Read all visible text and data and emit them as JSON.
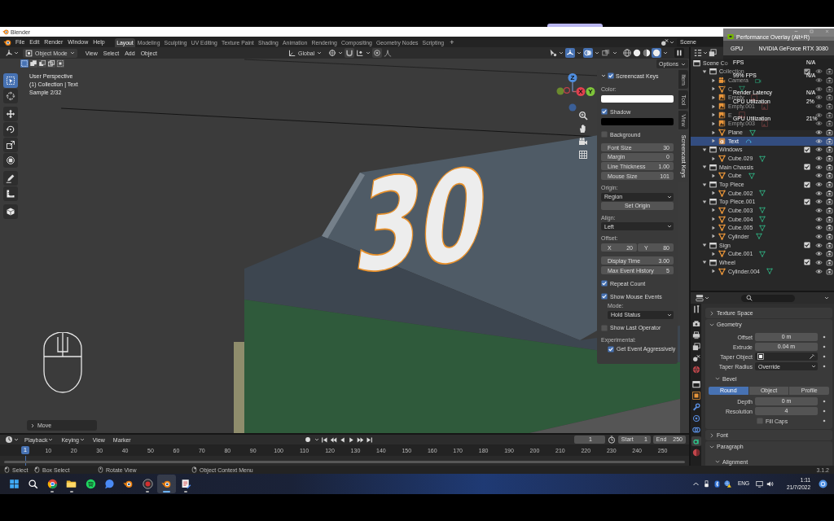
{
  "window": {
    "title": "Blender"
  },
  "topbar": {
    "menus": [
      "File",
      "Edit",
      "Render",
      "Window",
      "Help"
    ],
    "workspaces": [
      {
        "label": "Layout",
        "selected": true
      },
      {
        "label": "Modeling",
        "selected": false
      },
      {
        "label": "Sculpting",
        "selected": false
      },
      {
        "label": "UV Editing",
        "selected": false
      },
      {
        "label": "Texture Paint",
        "selected": false
      },
      {
        "label": "Shading",
        "selected": false
      },
      {
        "label": "Animation",
        "selected": false
      },
      {
        "label": "Rendering",
        "selected": false
      },
      {
        "label": "Compositing",
        "selected": false
      },
      {
        "label": "Geometry Nodes",
        "selected": false
      },
      {
        "label": "Scripting",
        "selected": false
      }
    ],
    "add_tab": "+",
    "scene": "Scene"
  },
  "performance_overlay": {
    "title": "Performance Overlay (Alt+R)",
    "gpu": {
      "label": "GPU",
      "value": "NVIDIA GeForce RTX 3080"
    },
    "stats": [
      {
        "label": "FPS",
        "value": "N/A"
      },
      {
        "label": "99% FPS",
        "value": "N/A"
      },
      {
        "label": "Render Latency",
        "value": "N/A"
      },
      {
        "label": "CPU Utilization",
        "value": "2%"
      },
      {
        "label": "GPU Utilization",
        "value": "21%"
      }
    ]
  },
  "viewport_header": {
    "mode": "Object Mode",
    "menus": [
      "View",
      "Select",
      "Add",
      "Object"
    ],
    "orientation": "Global",
    "toggles": [
      {
        "kind": "gizmos",
        "on": true
      },
      {
        "kind": "overlays",
        "on": true
      },
      {
        "kind": "xray",
        "on": false
      }
    ],
    "shading": [
      {
        "kind": "wireframe",
        "selected": false
      },
      {
        "kind": "solid",
        "selected": false
      },
      {
        "kind": "material",
        "selected": false
      },
      {
        "kind": "rendered",
        "selected": true
      }
    ],
    "options": "Options"
  },
  "select_modes": [
    {
      "kind": "set",
      "selected": true
    },
    {
      "kind": "extend",
      "selected": false
    },
    {
      "kind": "subtract",
      "selected": false
    },
    {
      "kind": "difference",
      "selected": false
    },
    {
      "kind": "intersect",
      "selected": false
    }
  ],
  "tools": [
    {
      "kind": "select",
      "selected": true
    },
    {
      "kind": "cursor",
      "selected": false
    },
    {
      "kind": "move",
      "selected": false
    },
    {
      "kind": "rotate",
      "selected": false
    },
    {
      "kind": "scale",
      "selected": false
    },
    {
      "kind": "transform",
      "selected": false
    },
    {
      "kind": "annotate",
      "selected": false
    },
    {
      "kind": "measure",
      "selected": false
    },
    {
      "kind": "add_cube",
      "selected": false
    }
  ],
  "viewport": {
    "info": [
      "User Perspective",
      "(1) Collection | Text",
      "Sample 2/32"
    ],
    "axes": [
      "Z",
      "X",
      "Y"
    ],
    "scene_text": "30",
    "last_operator": {
      "label": "Move",
      "expanded": false
    }
  },
  "sidebar": {
    "tabs": [
      {
        "label": "Item",
        "selected": false
      },
      {
        "label": "Tool",
        "selected": false
      },
      {
        "label": "View",
        "selected": false
      },
      {
        "label": "Screencast Keys",
        "selected": true
      }
    ],
    "panel": {
      "title": "Screencast Keys",
      "enabled": true,
      "expanded": true,
      "items": [
        {
          "kind": "label",
          "text": "Color:"
        },
        {
          "kind": "color",
          "color": "#ffffff"
        },
        {
          "kind": "checkbox",
          "label": "Shadow",
          "checked": true
        },
        {
          "kind": "color",
          "color": "#000000"
        },
        {
          "kind": "checkbox",
          "label": "Background",
          "checked": false
        },
        {
          "kind": "number",
          "label": "Font Size",
          "value": "30"
        },
        {
          "kind": "number",
          "label": "Margin",
          "value": "0"
        },
        {
          "kind": "number",
          "label": "Line Thickness",
          "value": "1.00"
        },
        {
          "kind": "number",
          "label": "Mouse Size",
          "value": "101"
        },
        {
          "kind": "label",
          "text": "Origin:"
        },
        {
          "kind": "dropdown",
          "value": "Region"
        },
        {
          "kind": "button",
          "label": "Set Origin"
        },
        {
          "kind": "label",
          "text": "Align:"
        },
        {
          "kind": "dropdown",
          "value": "Left"
        },
        {
          "kind": "label",
          "text": "Offset:"
        },
        {
          "kind": "pair",
          "fields": [
            {
              "label": "X",
              "value": "20"
            },
            {
              "label": "Y",
              "value": "80"
            }
          ]
        },
        {
          "kind": "number",
          "label": "Display Time",
          "value": "3.00"
        },
        {
          "kind": "number",
          "label": "Max Event History",
          "value": "5"
        },
        {
          "kind": "checkbox",
          "label": "Repeat Count",
          "checked": true
        },
        {
          "kind": "checkbox",
          "label": "Show Mouse Events",
          "checked": true,
          "children": [
            {
              "kind": "label",
              "text": "Mode:"
            },
            {
              "kind": "dropdown",
              "value": "Hold Status"
            }
          ]
        },
        {
          "kind": "checkbox",
          "label": "Show Last Operator",
          "checked": false
        },
        {
          "kind": "label",
          "text": "Experimental:",
          "children": [
            {
              "kind": "checkbox",
              "label": "Get Event Aggressively",
              "checked": true
            }
          ]
        }
      ]
    }
  },
  "outliner": {
    "tree": [
      {
        "name": "Scene Co",
        "kind": "scene_collection",
        "selected": false,
        "children": [
          {
            "name": "Collection",
            "kind": "collection",
            "expanded": true,
            "checked": true,
            "selected": false,
            "children": [
              {
                "name": "Camera",
                "kind": "camera",
                "expanded": false,
                "selected": false
              },
              {
                "name": "C",
                "kind": "mesh",
                "expanded": false,
                "selected": false
              },
              {
                "name": "Empty",
                "kind": "image_empty",
                "expanded": false,
                "selected": false
              },
              {
                "name": "Empty.001",
                "kind": "image_empty",
                "expanded": false,
                "selected": false
              },
              {
                "name": "E",
                "kind": "image_empty",
                "expanded": false,
                "selected": false
              },
              {
                "name": "Empty.003",
                "kind": "image_empty",
                "expanded": false,
                "selected": false
              },
              {
                "name": "Plane",
                "kind": "mesh",
                "expanded": false,
                "selected": false
              },
              {
                "name": "Text",
                "kind": "text",
                "expanded": false,
                "selected": true
              }
            ]
          },
          {
            "name": "Windows",
            "kind": "collection",
            "expanded": true,
            "checked": true,
            "selected": false,
            "children": [
              {
                "name": "Cube.029",
                "kind": "mesh",
                "expanded": false,
                "selected": false
              }
            ]
          },
          {
            "name": "Main Chassis",
            "kind": "collection",
            "expanded": true,
            "checked": true,
            "selected": false,
            "children": [
              {
                "name": "Cube",
                "kind": "mesh",
                "expanded": false,
                "selected": false
              }
            ]
          },
          {
            "name": "Top Piece",
            "kind": "collection",
            "expanded": true,
            "checked": true,
            "selected": false,
            "children": [
              {
                "name": "Cube.002",
                "kind": "mesh",
                "expanded": false,
                "selected": false
              }
            ]
          },
          {
            "name": "Top Piece.001",
            "kind": "collection",
            "expanded": true,
            "checked": true,
            "selected": false,
            "children": [
              {
                "name": "Cube.003",
                "kind": "mesh",
                "expanded": false,
                "selected": false
              },
              {
                "name": "Cube.004",
                "kind": "mesh",
                "expanded": false,
                "selected": false
              },
              {
                "name": "Cube.005",
                "kind": "mesh",
                "expanded": false,
                "selected": false
              },
              {
                "name": "Cylinder",
                "kind": "mesh",
                "expanded": false,
                "selected": false
              }
            ]
          },
          {
            "name": "Sign",
            "kind": "collection",
            "expanded": true,
            "checked": true,
            "selected": false,
            "children": [
              {
                "name": "Cube.001",
                "kind": "mesh",
                "expanded": false,
                "selected": false
              }
            ]
          },
          {
            "name": "Wheel",
            "kind": "collection",
            "expanded": true,
            "checked": true,
            "selected": false,
            "children": [
              {
                "name": "Cylinder.004",
                "kind": "mesh",
                "expanded": false,
                "selected": false
              }
            ]
          }
        ]
      }
    ]
  },
  "properties": {
    "tabs": [
      {
        "kind": "tool",
        "selected": false
      },
      {
        "kind": "render",
        "selected": false
      },
      {
        "kind": "output",
        "selected": false
      },
      {
        "kind": "view_layer",
        "selected": false
      },
      {
        "kind": "scene",
        "selected": false
      },
      {
        "kind": "world",
        "selected": false
      },
      {
        "kind": "collection",
        "selected": false
      },
      {
        "kind": "object",
        "selected": false
      },
      {
        "kind": "modifiers",
        "selected": false
      },
      {
        "kind": "particles",
        "selected": false
      },
      {
        "kind": "physics",
        "selected": false
      },
      {
        "kind": "data",
        "selected": true
      },
      {
        "kind": "material",
        "selected": false
      }
    ],
    "panels": [
      {
        "title": "Texture Space",
        "expanded": false
      },
      {
        "title": "Geometry",
        "expanded": true,
        "items": [
          {
            "kind": "number",
            "label": "Offset",
            "value": "0 m"
          },
          {
            "kind": "number",
            "label": "Extrude",
            "value": "0.04 m"
          },
          {
            "kind": "object",
            "label": "Taper Object"
          },
          {
            "kind": "dropdown",
            "label": "Taper Radius",
            "value": "Override"
          }
        ],
        "subpanels": [
          {
            "title": "Bevel",
            "expanded": true,
            "modes": [
              {
                "label": "Round",
                "selected": true
              },
              {
                "label": "Object",
                "selected": false
              },
              {
                "label": "Profile",
                "selected": false
              }
            ],
            "items": [
              {
                "kind": "number",
                "label": "Depth",
                "value": "0 m"
              },
              {
                "kind": "number",
                "label": "Resolution",
                "value": "4"
              },
              {
                "kind": "checkbox",
                "label": "Fill Caps",
                "checked": false
              }
            ]
          }
        ]
      },
      {
        "title": "Font",
        "expanded": false
      },
      {
        "title": "Paragraph",
        "expanded": true,
        "subpanels": [
          {
            "title": "Alignment",
            "expanded": true
          }
        ]
      }
    ]
  },
  "timeline": {
    "menus": [
      {
        "label": "Playback",
        "kind": "dropdown"
      },
      {
        "label": "Keying",
        "kind": "dropdown"
      },
      {
        "label": "View",
        "kind": "menu"
      },
      {
        "label": "Marker",
        "kind": "menu"
      }
    ],
    "auto_keying": false,
    "current_frame": "1",
    "start": {
      "label": "Start",
      "value": "1"
    },
    "end": {
      "label": "End",
      "value": "250"
    },
    "playhead": "1",
    "ruler": [
      "10",
      "20",
      "30",
      "40",
      "50",
      "60",
      "70",
      "80",
      "90",
      "100",
      "110",
      "120",
      "130",
      "140",
      "150",
      "160",
      "170",
      "180",
      "190",
      "200",
      "210",
      "220",
      "230",
      "240",
      "250"
    ]
  },
  "status_bar": {
    "hints": [
      {
        "kind": "left_click",
        "label": "Select"
      },
      {
        "kind": "drag",
        "label": "Box Select"
      },
      {
        "kind": "middle_click",
        "label": "Rotate View"
      },
      {
        "kind": "right_click",
        "label": "Object Context Menu"
      }
    ],
    "version": "3.1.2"
  },
  "taskbar": {
    "apps": [
      {
        "kind": "start",
        "running": false,
        "selected": false
      },
      {
        "kind": "search",
        "running": false,
        "selected": false
      },
      {
        "kind": "browser",
        "running": true,
        "selected": false
      },
      {
        "kind": "folder",
        "running": true,
        "selected": false
      },
      {
        "kind": "music",
        "running": false,
        "selected": false
      },
      {
        "kind": "chat",
        "running": false,
        "selected": false
      },
      {
        "kind": "blender",
        "running": false,
        "selected": false
      },
      {
        "kind": "record",
        "running": true,
        "selected": false
      },
      {
        "kind": "blender",
        "running": true,
        "selected": true
      },
      {
        "kind": "editor",
        "running": true,
        "selected": false
      }
    ],
    "language": "ENG",
    "time": "1:11",
    "date": "21/7/2022"
  }
}
